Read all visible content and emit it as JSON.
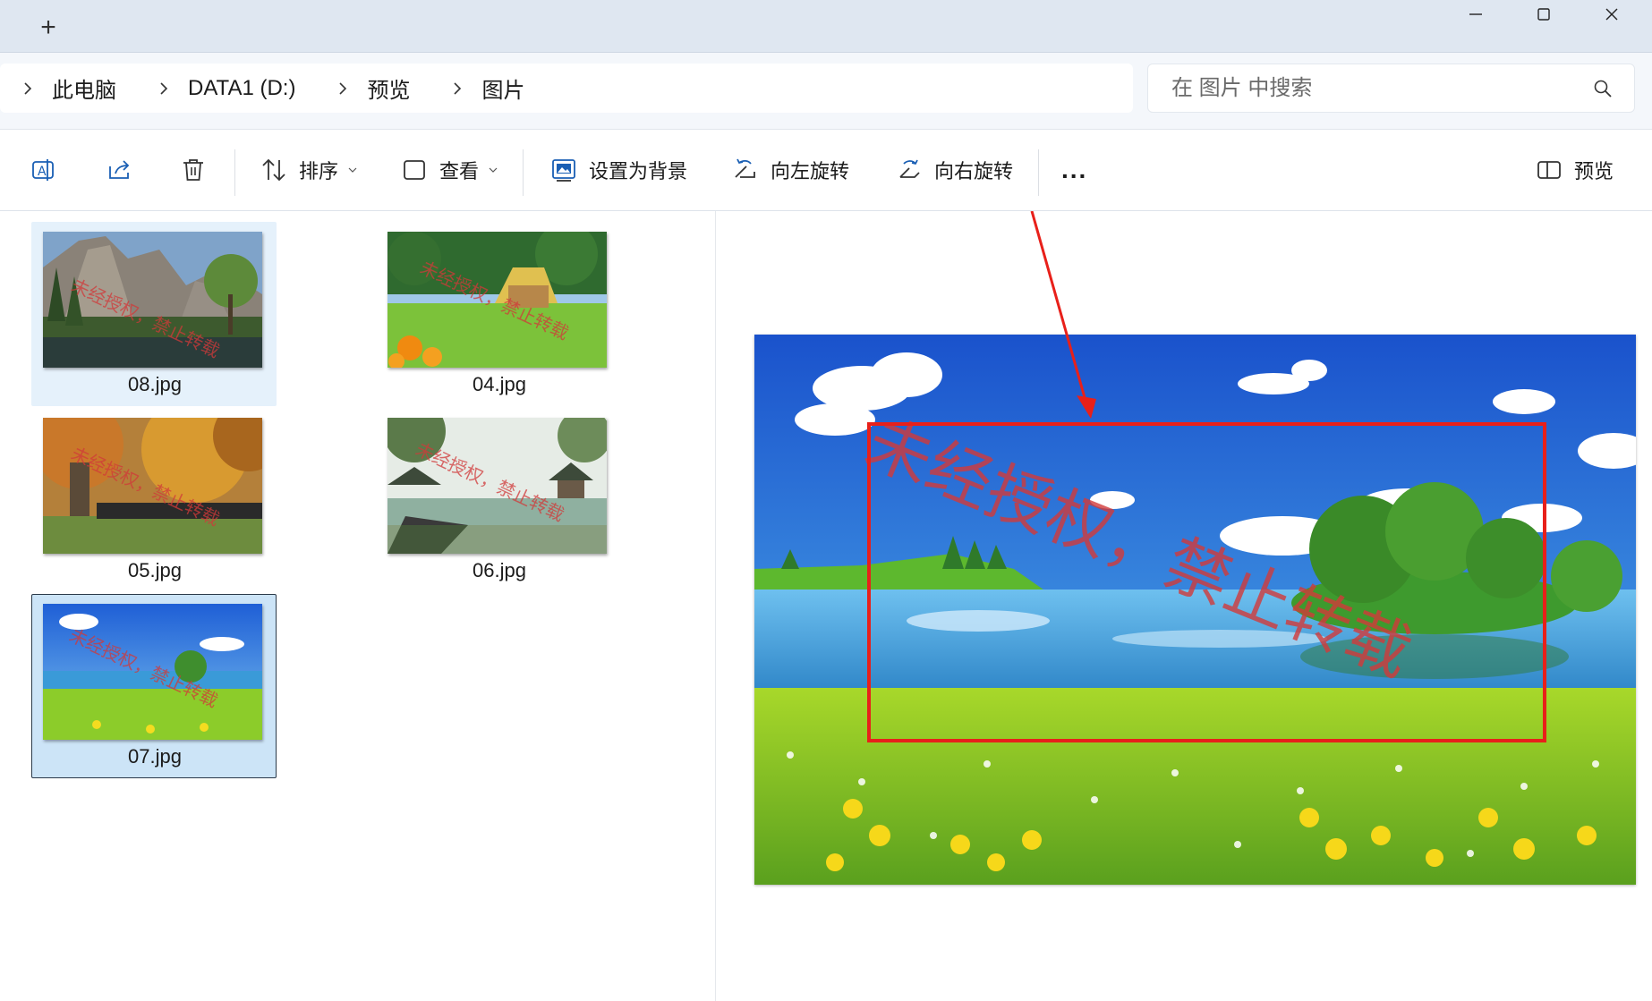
{
  "window": {
    "new_tab_glyph": "+",
    "controls": [
      "minimize-icon",
      "maximize-icon",
      "close-icon"
    ]
  },
  "address": {
    "crumbs": [
      "此电脑",
      "DATA1 (D:)",
      "预览",
      "图片"
    ],
    "search_placeholder": "在 图片 中搜索"
  },
  "toolbar": {
    "sort_label": "排序",
    "view_label": "查看",
    "set_background_label": "设置为背景",
    "rotate_left_label": "向左旋转",
    "rotate_right_label": "向右旋转",
    "more_label": "...",
    "preview_label": "预览"
  },
  "files": [
    {
      "name": "08.jpg",
      "state": "hover",
      "scene": "mountain-lake"
    },
    {
      "name": "04.jpg",
      "state": "normal",
      "scene": "cottage-meadow"
    },
    {
      "name": "05.jpg",
      "state": "normal",
      "scene": "autumn-trees"
    },
    {
      "name": "06.jpg",
      "state": "normal",
      "scene": "chinese-garden"
    },
    {
      "name": "07.jpg",
      "state": "selected",
      "scene": "lake-meadow"
    }
  ],
  "preview": {
    "watermark": "未经授权，禁止转载",
    "annotation_color": "#e8201a"
  },
  "colors": {
    "selection": "#cce4f7",
    "hover": "#e5f1fb",
    "titlebar": "#dfe7f1"
  }
}
